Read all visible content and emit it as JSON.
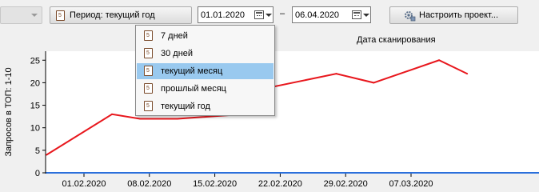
{
  "toolbar": {
    "period_button": "Период: текущий год",
    "date_from": "01.01.2020",
    "date_separator": "–",
    "date_to": "06.04.2020",
    "settings_button": "Настроить проект..."
  },
  "period_menu": {
    "items": [
      "7 дней",
      "30 дней",
      "текущий месяц",
      "прошлый месяц",
      "текущий год"
    ],
    "selected": "текущий месяц"
  },
  "chart_data": {
    "type": "line",
    "title": "Дата сканирования",
    "ylabel": "Запросов в ТОП: 1-10",
    "ylim": [
      0,
      27
    ],
    "yticks": [
      0,
      5,
      10,
      15,
      20,
      25
    ],
    "xtick_labels": [
      "01.02.2020",
      "08.02.2020",
      "15.02.2020",
      "22.02.2020",
      "29.02.2020",
      "07.03.2020"
    ],
    "colors": {
      "series": "#e8171d",
      "baseline": "#1f5fd1"
    },
    "series": [
      {
        "x": [
          "2020-01-28",
          "2020-02-04",
          "2020-02-07",
          "2020-02-11",
          "2020-02-18",
          "2020-02-21",
          "2020-02-28",
          "2020-03-03",
          "2020-03-10",
          "2020-03-13"
        ],
        "values": [
          4,
          13,
          12,
          12,
          13,
          19,
          22,
          20,
          25,
          22
        ]
      }
    ]
  }
}
